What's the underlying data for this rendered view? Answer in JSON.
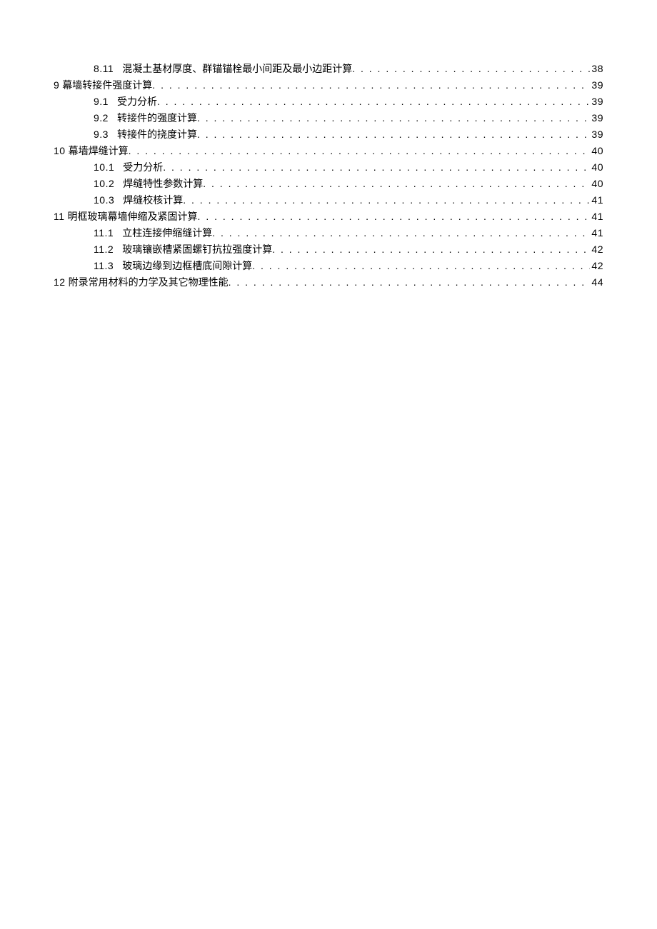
{
  "toc": {
    "entries": [
      {
        "level": 2,
        "number": "8.11",
        "title": "混凝土基材厚度、群锚锚栓最小间距及最小边距计算",
        "page": "38"
      },
      {
        "level": 1,
        "number": "9",
        "title": "幕墙转接件强度计算",
        "page": "39"
      },
      {
        "level": 2,
        "number": "9.1",
        "title": "受力分析",
        "page": "39"
      },
      {
        "level": 2,
        "number": "9.2",
        "title": "转接件的强度计算",
        "page": "39"
      },
      {
        "level": 2,
        "number": "9.3",
        "title": "转接件的挠度计算",
        "page": "39"
      },
      {
        "level": 1,
        "number": "10",
        "title": "幕墙焊缝计算",
        "page": "40"
      },
      {
        "level": 2,
        "number": "10.1",
        "title": "受力分析",
        "page": "40"
      },
      {
        "level": 2,
        "number": "10.2",
        "title": "焊缝特性参数计算",
        "page": "40"
      },
      {
        "level": 2,
        "number": "10.3",
        "title": "焊缝校核计算",
        "page": "41"
      },
      {
        "level": 1,
        "number": "11",
        "title": "明框玻璃幕墙伸缩及紧固计算",
        "page": "41"
      },
      {
        "level": 2,
        "number": "11.1",
        "title": "立柱连接伸缩缝计算",
        "page": "41"
      },
      {
        "level": 2,
        "number": "11.2",
        "title": "玻璃镶嵌槽紧固螺钉抗拉强度计算",
        "page": "42"
      },
      {
        "level": 2,
        "number": "11.3",
        "title": "玻璃边缘到边框槽底间隙计算",
        "page": "42"
      },
      {
        "level": 1,
        "number": "12",
        "title": "附录常用材料的力学及其它物理性能",
        "page": "44"
      }
    ]
  }
}
